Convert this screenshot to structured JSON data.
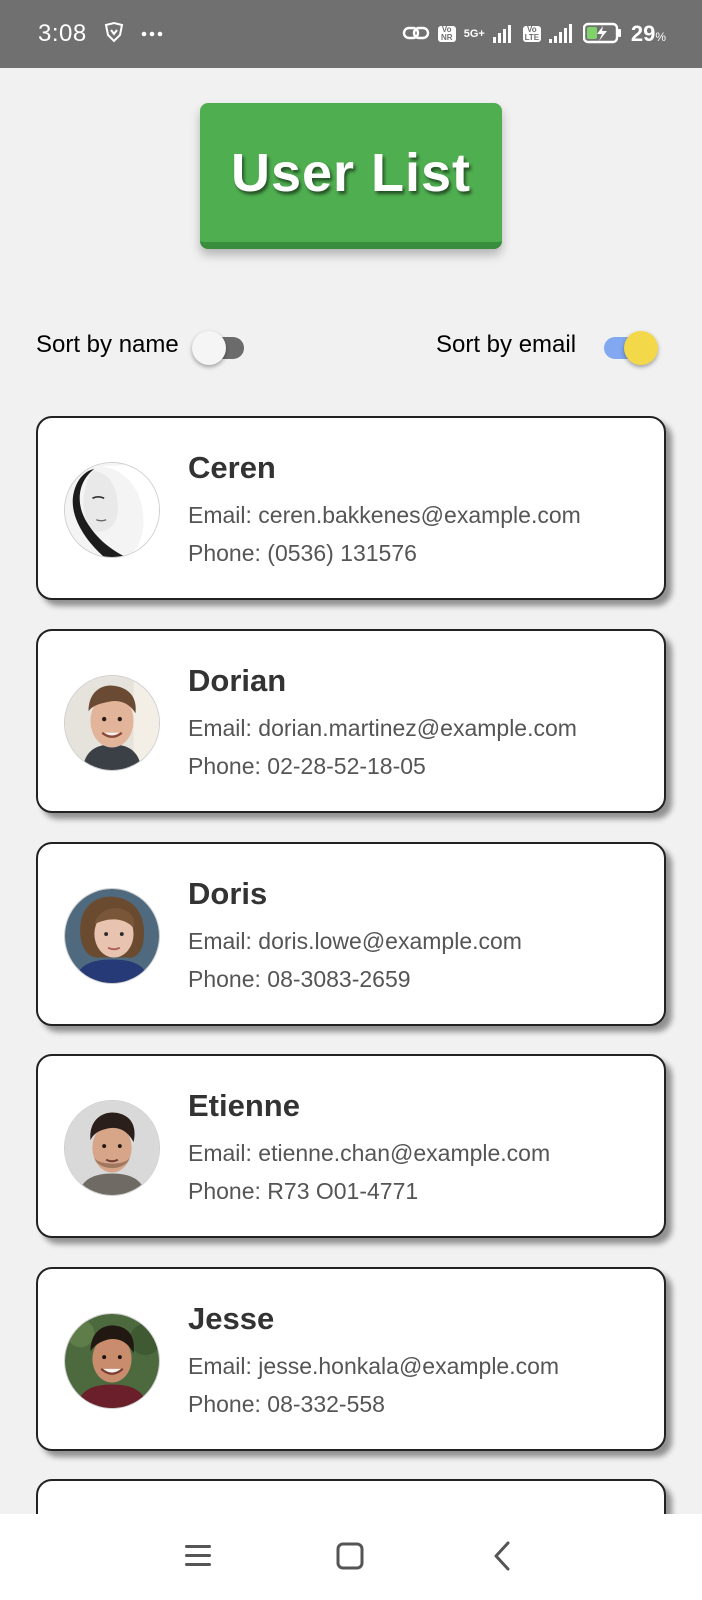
{
  "status_bar": {
    "time": "3:08",
    "volte_badge_1": "Vo NR",
    "network_label": "5G+",
    "volte_badge_2": "Vo LTE",
    "battery": "29",
    "battery_unit": "%"
  },
  "header": {
    "title": "User List"
  },
  "sort": {
    "by_name_label": "Sort by name",
    "by_name_enabled": false,
    "by_email_label": "Sort by email",
    "by_email_enabled": true
  },
  "users": [
    {
      "name": "Ceren",
      "email": "Email: ceren.bakkenes@example.com",
      "phone": "Phone: (0536) 131576"
    },
    {
      "name": "Dorian",
      "email": "Email: dorian.martinez@example.com",
      "phone": "Phone: 02-28-52-18-05"
    },
    {
      "name": "Doris",
      "email": "Email: doris.lowe@example.com",
      "phone": "Phone: 08-3083-2659"
    },
    {
      "name": "Etienne",
      "email": "Email: etienne.chan@example.com",
      "phone": "Phone: R73 O01-4771"
    },
    {
      "name": "Jesse",
      "email": "Email: jesse.honkala@example.com",
      "phone": "Phone: 08-332-558"
    }
  ],
  "icons": {
    "status": [
      "brave-lion-icon",
      "more-dots-icon",
      "hotspot-link-icon",
      "signal-icon",
      "battery-charging-icon"
    ],
    "nav": [
      "menu-icon",
      "home-icon",
      "back-icon"
    ]
  }
}
